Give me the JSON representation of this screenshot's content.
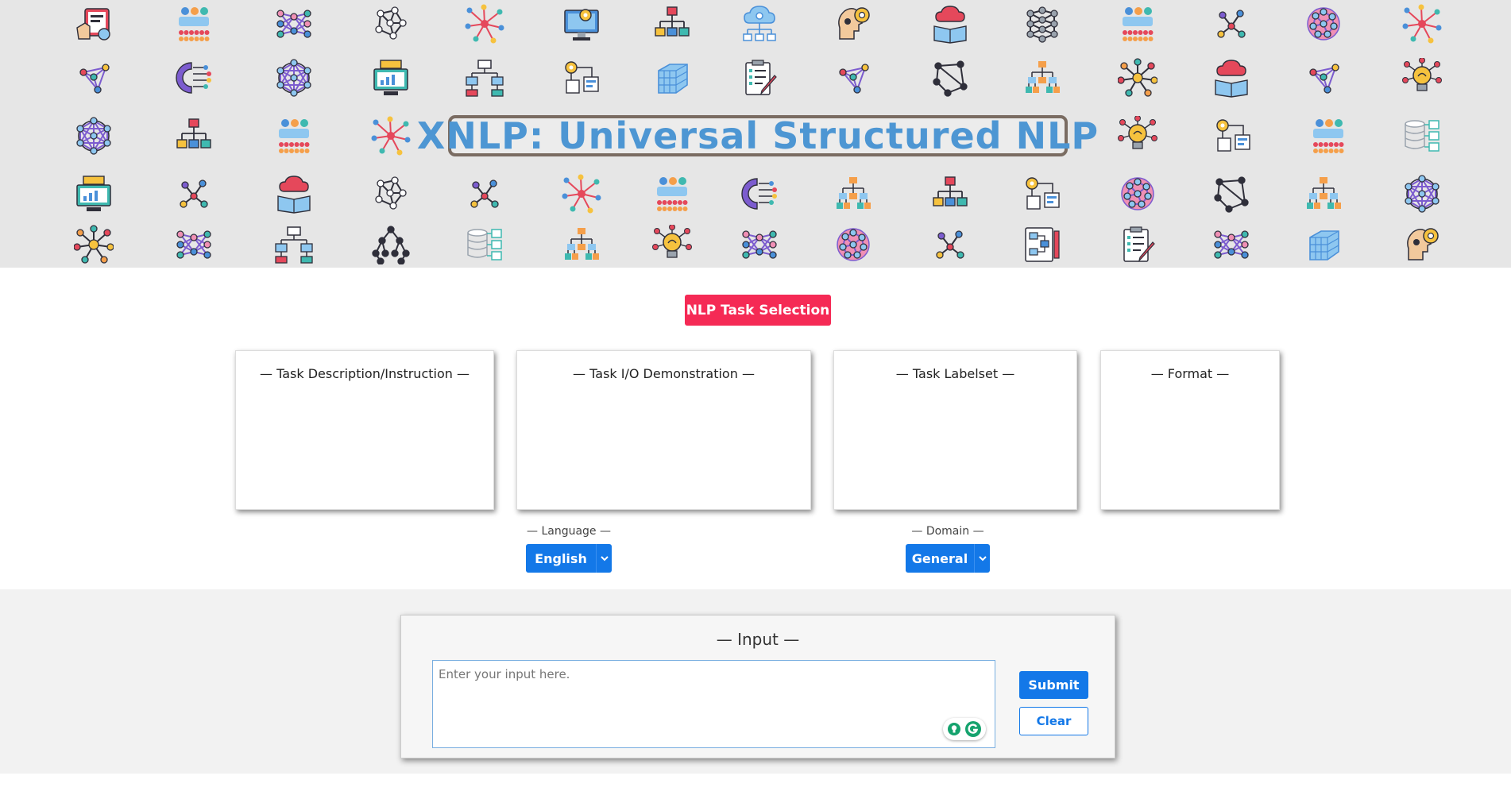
{
  "banner": {
    "title": "XNLP: Universal Structured NLP",
    "icons": [
      [
        "worker-tablet-icon",
        "neural-network-people-icon",
        "neural-network-icon",
        "network-graph-icon",
        "starburst-network-icon",
        "computer-settings-icon",
        "hierarchy-icon",
        "cloud-hierarchy-icon",
        "ai-head-gear-icon",
        "cloud-book-icon",
        "dense-network-icon",
        "neural-network-people-icon",
        "molecule-icon",
        "brain-icon",
        "starburst-network-icon"
      ],
      [
        "molecule-triangle-icon",
        "gear-circuit-icon",
        "sphere-network-icon",
        "monitor-chart-icon",
        "org-chart-icon",
        "workflow-settings-icon",
        "cube-grid-icon",
        "clipboard-pen-icon",
        "molecule-triangle-icon",
        "polygon-network-icon",
        "tree-hierarchy-icon",
        "hub-network-icon",
        "cloud-book-icon",
        "molecule-triangle-icon",
        "lightbulb-idea-icon"
      ],
      [
        "sphere-network-icon",
        "hierarchy-icon",
        "neural-network-people-icon",
        "starburst-network-icon",
        "lightbulb-idea-icon",
        "workflow-settings-icon",
        "neural-network-people-icon",
        "database-blocks-icon"
      ],
      [
        "monitor-chart-icon",
        "molecule-icon",
        "cloud-book-icon",
        "network-graph-icon",
        "molecule-icon",
        "starburst-network-icon",
        "neural-network-people-icon",
        "gear-circuit-icon",
        "tree-hierarchy-icon",
        "hierarchy-icon",
        "workflow-settings-icon",
        "brain-icon",
        "polygon-network-icon",
        "tree-hierarchy-icon",
        "sphere-network-icon"
      ],
      [
        "hub-network-icon",
        "neural-network-icon",
        "org-chart-icon",
        "tree-graph-icon",
        "database-blocks-icon",
        "tree-hierarchy-icon",
        "lightbulb-idea-icon",
        "neural-network-icon",
        "brain-icon",
        "molecule-icon",
        "document-flow-icon",
        "clipboard-pen-icon",
        "neural-network-icon",
        "cube-grid-icon",
        "ai-head-gear-icon"
      ]
    ]
  },
  "task": {
    "button": "NLP Task Selection",
    "cards": [
      {
        "heading": "— Task Description/Instruction —"
      },
      {
        "heading": "— Task I/O Demonstration —"
      },
      {
        "heading": "— Task Labelset —"
      },
      {
        "heading": "— Format —"
      }
    ],
    "language": {
      "label": "— Language —",
      "value": "English"
    },
    "domain": {
      "label": "— Domain —",
      "value": "General"
    }
  },
  "input": {
    "title": "— Input —",
    "placeholder": "Enter your input here.",
    "submit": "Submit",
    "clear": "Clear"
  },
  "colors": {
    "accent": "#1378e8",
    "task_button": "#f52a55",
    "title_text": "#4d96d3",
    "banner_bg": "#e6e6e6"
  }
}
